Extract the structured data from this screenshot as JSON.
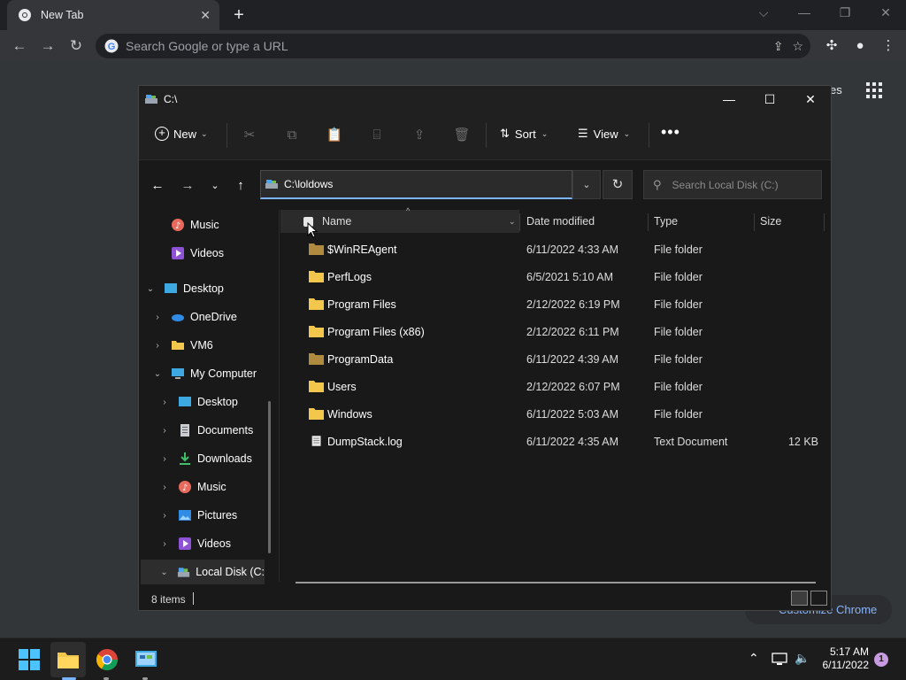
{
  "chrome": {
    "tab_title": "New Tab",
    "omnibox_placeholder": "Search Google or type a URL",
    "apps_partial_text": "es",
    "customize_label": "Customize Chrome"
  },
  "explorer": {
    "title": "C:\\",
    "commands": {
      "new_label": "New",
      "sort_label": "Sort",
      "view_label": "View"
    },
    "address": "C:\\loldows",
    "search_placeholder": "Search Local Disk (C:)",
    "nav_pane": [
      {
        "label": "Music",
        "icon": "music-icon"
      },
      {
        "label": "Videos",
        "icon": "videos-icon"
      },
      {
        "label": "Desktop",
        "icon": "desktop-icon"
      },
      {
        "label": "OneDrive",
        "icon": "onedrive-icon"
      },
      {
        "label": "VM6",
        "icon": "folder-icon"
      },
      {
        "label": "My Computer",
        "icon": "computer-icon"
      },
      {
        "label": "Desktop",
        "icon": "desktop-icon"
      },
      {
        "label": "Documents",
        "icon": "documents-icon"
      },
      {
        "label": "Downloads",
        "icon": "downloads-icon"
      },
      {
        "label": "Music",
        "icon": "music-icon"
      },
      {
        "label": "Pictures",
        "icon": "pictures-icon"
      },
      {
        "label": "Videos",
        "icon": "videos-icon"
      },
      {
        "label": "Local Disk (C:",
        "icon": "drive-icon"
      }
    ],
    "columns": {
      "name": "Name",
      "date": "Date modified",
      "type": "Type",
      "size": "Size"
    },
    "files": [
      {
        "name": "$WinREAgent",
        "date": "6/11/2022 4:33 AM",
        "type": "File folder",
        "size": "",
        "icon": "folder-dim-icon"
      },
      {
        "name": "PerfLogs",
        "date": "6/5/2021 5:10 AM",
        "type": "File folder",
        "size": "",
        "icon": "folder-icon"
      },
      {
        "name": "Program Files",
        "date": "2/12/2022 6:19 PM",
        "type": "File folder",
        "size": "",
        "icon": "folder-icon"
      },
      {
        "name": "Program Files (x86)",
        "date": "2/12/2022 6:11 PM",
        "type": "File folder",
        "size": "",
        "icon": "folder-icon"
      },
      {
        "name": "ProgramData",
        "date": "6/11/2022 4:39 AM",
        "type": "File folder",
        "size": "",
        "icon": "folder-dim-icon"
      },
      {
        "name": "Users",
        "date": "2/12/2022 6:07 PM",
        "type": "File folder",
        "size": "",
        "icon": "folder-icon"
      },
      {
        "name": "Windows",
        "date": "6/11/2022 5:03 AM",
        "type": "File folder",
        "size": "",
        "icon": "folder-icon"
      },
      {
        "name": "DumpStack.log",
        "date": "6/11/2022 4:35 AM",
        "type": "Text Document",
        "size": "12 KB",
        "icon": "text-file-icon"
      }
    ],
    "status_count": "8 items"
  },
  "taskbar": {
    "time": "5:17 AM",
    "date": "6/11/2022",
    "notification_count": "1"
  },
  "colors": {
    "folder": "#f3c74b",
    "folder_dim": "#b08a3e",
    "accent_blue": "#7ab4ff",
    "taskbar": "#1c1c1c"
  }
}
